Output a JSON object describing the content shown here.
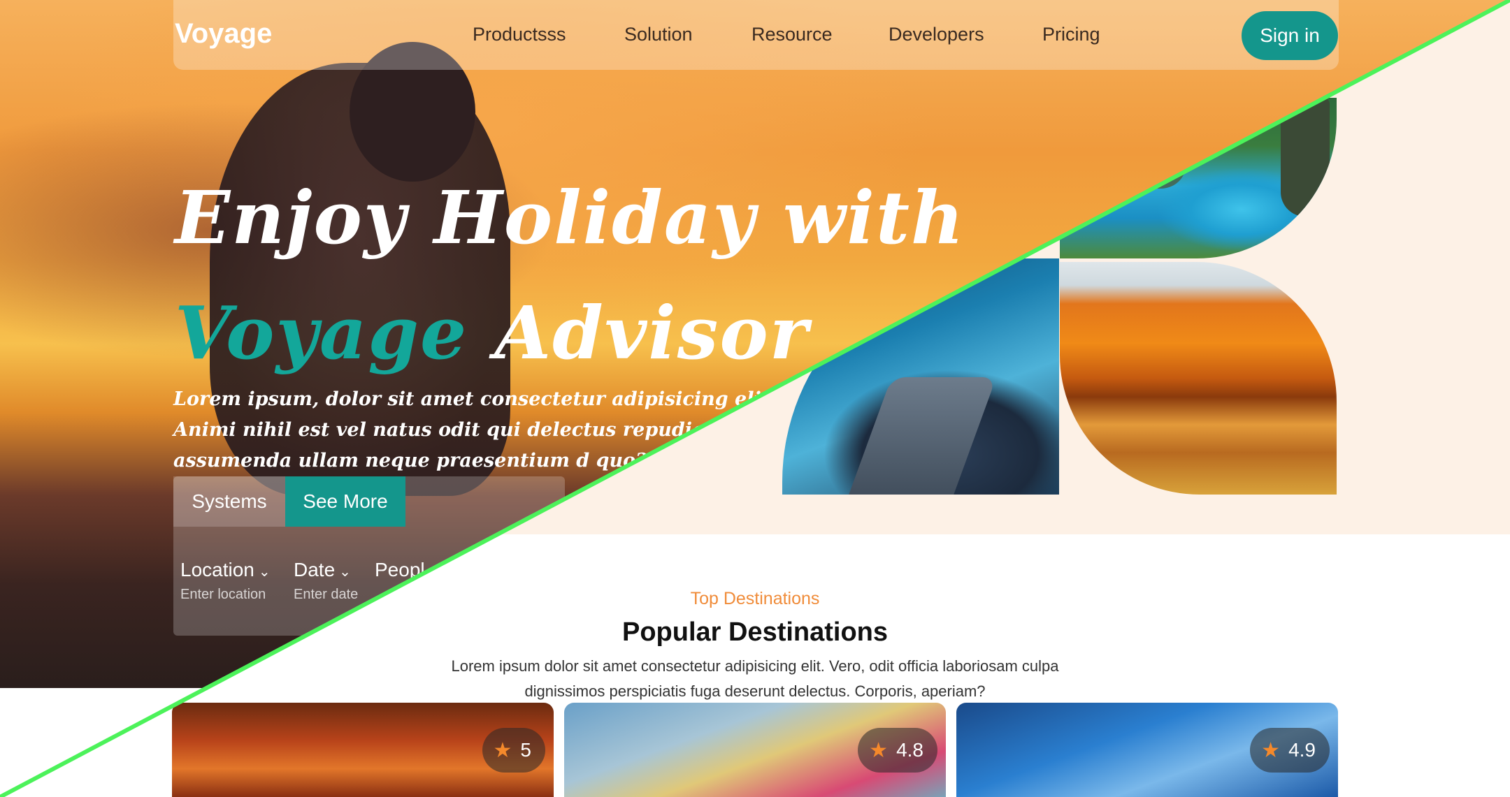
{
  "nav": {
    "brand": "Voyage",
    "items": [
      "Productsss",
      "Solution",
      "Resource",
      "Developers",
      "Pricing"
    ],
    "signin": "Sign in"
  },
  "hero": {
    "line1": "Enjoy Holiday with",
    "line2_accent": "Voyage",
    "line2_rest": "Advisor",
    "description": "Lorem ipsum, dolor sit amet consectetur adipisicing elit. Animi nihil est vel natus odit qui delectus repudiandae tenetur assumenda ullam neque praesentium d quo?",
    "tabs": [
      "Systems",
      "See More"
    ],
    "fields": [
      {
        "label": "Location",
        "placeholder": "Enter location"
      },
      {
        "label": "Date",
        "placeholder": "Enter date"
      },
      {
        "label": "Peopl",
        "placeholder": ""
      }
    ]
  },
  "section": {
    "eyebrow": "Top Destinations",
    "title": "Popular Destinations",
    "description": "Lorem ipsum dolor sit amet consectetur adipisicing elit. Vero, odit officia laboriosam culpa dignissimos perspiciatis fuga deserunt delectus. Corporis, aperiam?"
  },
  "cards": [
    {
      "rating": "5"
    },
    {
      "rating": "4.8"
    },
    {
      "rating": "4.9"
    }
  ],
  "colors": {
    "accent": "#14968c",
    "eyebrow": "#f08c3a",
    "cream": "#fdf1e6",
    "diagonal": "#4cf25a"
  },
  "icons": {
    "star": "star-icon",
    "chevron": "chevron-down-icon"
  }
}
